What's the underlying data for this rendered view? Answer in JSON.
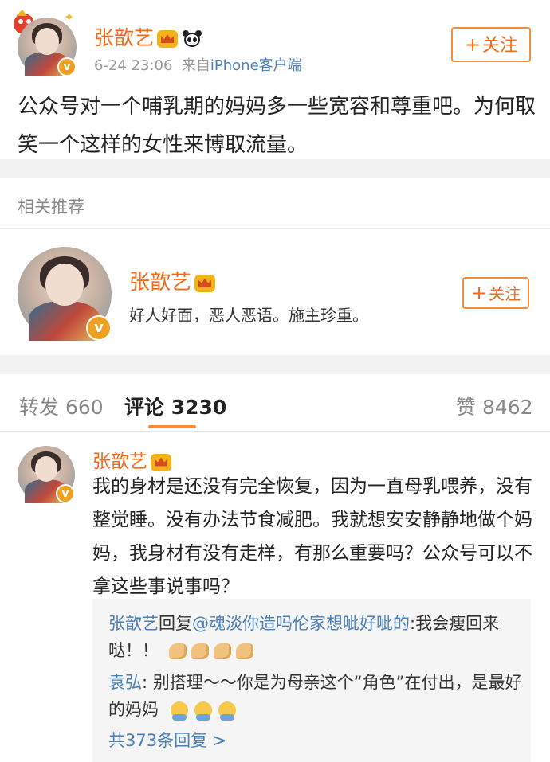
{
  "post": {
    "author": "张歆艺",
    "time": "6-24 23:06",
    "source_prefix": "来自",
    "source": "iPhone客户端",
    "follow_label": "关注",
    "text": "公众号对一个哺乳期的妈妈多一些宽容和尊重吧。为何取笑一个这样的女性来博取流量。"
  },
  "recommend": {
    "title": "相关推荐",
    "name": "张歆艺",
    "bio": "好人好面，恶人恶语。施主珍重。",
    "follow_label": "关注"
  },
  "tabs": {
    "repost_label": "转发",
    "repost_count": "660",
    "comment_label": "评论",
    "comment_count": "3230",
    "like_label": "赞",
    "like_count": "8462"
  },
  "comment": {
    "author": "张歆艺",
    "text": "我的身材是还没有完全恢复，因为一直母乳喂养，没有整觉睡。没有办法节食减肥。我就想安安静静地做个妈妈，我身材有没有走样，有那么重要吗？公众号可以不拿这些事说事吗？",
    "replies": [
      {
        "who": "张歆艺",
        "action": "回复",
        "target": "@魂淡你造吗伦家想呲好呲的",
        "text": ":我会瘦回来哒！！"
      },
      {
        "who": "袁弘",
        "text": ": 别搭理～～你是为母亲这个“角色”在付出，是最好的妈妈"
      }
    ],
    "more_label": "共373条回复 >"
  },
  "colors": {
    "accent": "#f26b1a",
    "link": "#4a7fb8",
    "tab_underline": "#f58d3d",
    "gap": "#f2f2f2"
  },
  "icons": {
    "verified": "v-badge-icon",
    "crown": "vip-crown-icon",
    "panda": "panda-icon",
    "plus": "plus-icon"
  }
}
